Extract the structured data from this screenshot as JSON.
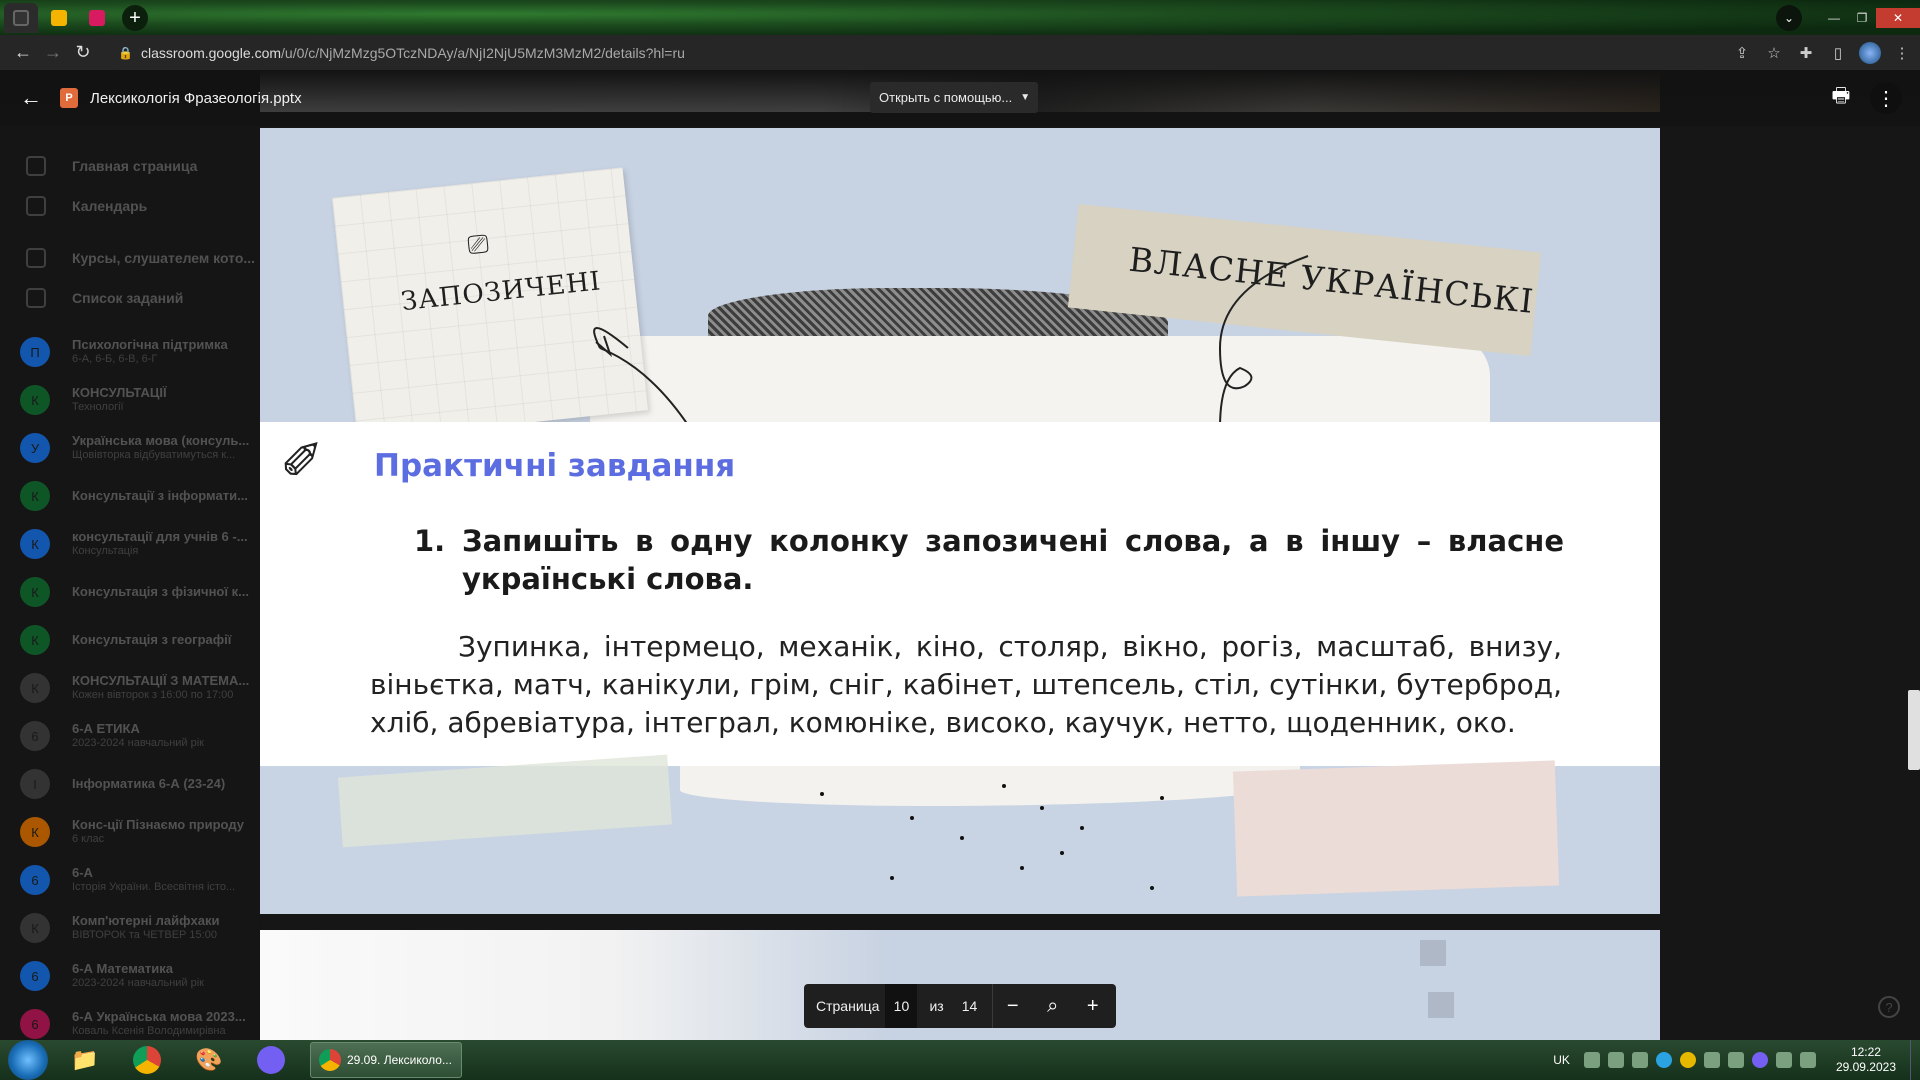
{
  "browser": {
    "url_host": "classroom.google.com",
    "url_path": "/u/0/c/NjMzMzg5OTczNDAy/a/NjI2NjU5MzM3MzM2/details?hl=ru"
  },
  "sidebar": {
    "nav": [
      {
        "label": "Главная страница"
      },
      {
        "label": "Календарь"
      },
      {
        "label": "Курсы, слушателем кото..."
      },
      {
        "label": "Список заданий"
      }
    ],
    "courses": [
      {
        "initial": "П",
        "name": "Психологічна підтримка",
        "sub": "6-А, 6-Б, 6-В, 6-Г",
        "color": "#1a73e8"
      },
      {
        "initial": "К",
        "name": "КОНСУЛЬТАЦІЇ",
        "sub": "Технології",
        "color": "#137333"
      },
      {
        "initial": "У",
        "name": "Українська мова (консуль...",
        "sub": "Щовівторка відбуватимуться к...",
        "color": "#1a73e8"
      },
      {
        "initial": "К",
        "name": "Консультації з інформати...",
        "sub": "",
        "color": "#137333"
      },
      {
        "initial": "К",
        "name": "консультації для учнів 6 -...",
        "sub": "Консультація",
        "color": "#1a73e8"
      },
      {
        "initial": "К",
        "name": "Консультація з фізичної к...",
        "sub": "",
        "color": "#137333"
      },
      {
        "initial": "К",
        "name": "Консультація з географії",
        "sub": "",
        "color": "#137333"
      },
      {
        "initial": "К",
        "name": "КОНСУЛЬТАЦІЇ З МАТЕМА...",
        "sub": "Кожен вівторок з 16:00 по 17:00",
        "color": "#444444"
      },
      {
        "initial": "6",
        "name": "6-А ЕТИКА",
        "sub": "2023-2024 навчальний рік",
        "color": "#444444"
      },
      {
        "initial": "І",
        "name": "Інформатика 6-А (23-24)",
        "sub": "",
        "color": "#444444"
      },
      {
        "initial": "К",
        "name": "Конс-ції Пізнаємо природу",
        "sub": "6 клас",
        "color": "#e37400"
      },
      {
        "initial": "6",
        "name": "6-А",
        "sub": "Історія України. Всесвітня істо...",
        "color": "#1a73e8"
      },
      {
        "initial": "К",
        "name": "Комп'ютерні лайфхаки",
        "sub": "ВІВТОРОК та ЧЕТВЕР 15:00",
        "color": "#444444"
      },
      {
        "initial": "6",
        "name": "6-А Математика",
        "sub": "2023-2024 навчальний рік",
        "color": "#1a73e8"
      },
      {
        "initial": "6",
        "name": "6-А Українська мова 2023...",
        "sub": "Коваль Ксенія Володимирівна",
        "color": "#c2185b"
      }
    ]
  },
  "viewer": {
    "file_type": "P",
    "file_name": "Лексикологія Фразеологія.pptx",
    "open_with": "Открыть с помощью..."
  },
  "slide": {
    "note_left": "ЗАПОЗИЧЕНІ",
    "note_right": "ВЛАСНЕ УКРАЇНСЬКІ",
    "section_title": "Практичні завдання",
    "task_number": "1.",
    "task_text": "Запишіть в одну колонку запозичені слова, а в іншу – власне українські слова.",
    "words": "Зупинка, інтермецо, механік, кіно, столяр, вікно, рогіз, масштаб, внизу, віньєтка, матч, канікули, грім, сніг, кабінет, штепсель, стіл, сутінки, бутерброд, хліб, абревіатура, інтеграл, комюніке, високо, каучук, нетто, щоденник, око."
  },
  "pager": {
    "label": "Страница",
    "current": "10",
    "of": "из",
    "total": "14"
  },
  "taskbar": {
    "window_title": "29.09. Лексиколо...",
    "lang": "UK",
    "time": "12:22",
    "date": "29.09.2023"
  }
}
